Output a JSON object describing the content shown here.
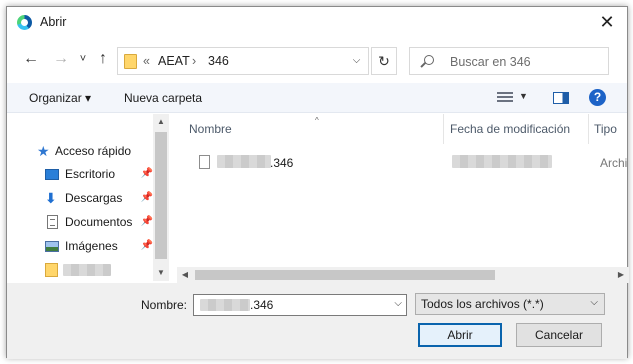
{
  "window": {
    "title": "Abrir",
    "close_symbol": "✕"
  },
  "nav": {
    "back_symbol": "←",
    "forward_symbol": "→",
    "recent_symbol": "˅",
    "up_symbol": "↑",
    "address_prefix": "«",
    "path": [
      "AEAT",
      "346"
    ],
    "path_separator": "›",
    "address_dropdown_symbol": "⌵",
    "refresh_symbol": "↻",
    "search_placeholder": "Buscar en 346"
  },
  "toolbar": {
    "organize_label": "Organizar ▾",
    "new_folder_label": "Nueva carpeta",
    "view_dropdown_symbol": "▼",
    "help_symbol": "?"
  },
  "sidebar": {
    "items": [
      {
        "label": "Acceso rápido",
        "icon": "star-icon",
        "pinned": false
      },
      {
        "label": "Escritorio",
        "icon": "desktop-icon",
        "pinned": true
      },
      {
        "label": "Descargas",
        "icon": "download-icon",
        "pinned": true
      },
      {
        "label": "Documentos",
        "icon": "documents-icon",
        "pinned": true
      },
      {
        "label": "Imágenes",
        "icon": "pictures-icon",
        "pinned": true
      },
      {
        "label": "",
        "icon": "folder-icon",
        "pinned": false
      }
    ],
    "pin_symbol": "📌"
  },
  "columns": {
    "name": "Nombre",
    "modified": "Fecha de modificación",
    "type": "Tipo",
    "sort_indicator": "^"
  },
  "files": [
    {
      "name_visible_suffix": ".346",
      "type": "Archi"
    }
  ],
  "footer": {
    "filename_label": "Nombre:",
    "filename_visible_suffix": ".346",
    "filter_value": "Todos los archivos (*.*)",
    "dropdown_symbol": "⌵",
    "open_label": "Abrir",
    "cancel_label": "Cancelar"
  },
  "scroll": {
    "up": "▲",
    "down": "▼",
    "left": "◀",
    "right": "▶"
  },
  "colors": {
    "accent": "#0a64ad",
    "folder": "#ffd66b",
    "toolbar_bg": "#f3f6fb",
    "footer_bg": "#f0f0f0"
  }
}
